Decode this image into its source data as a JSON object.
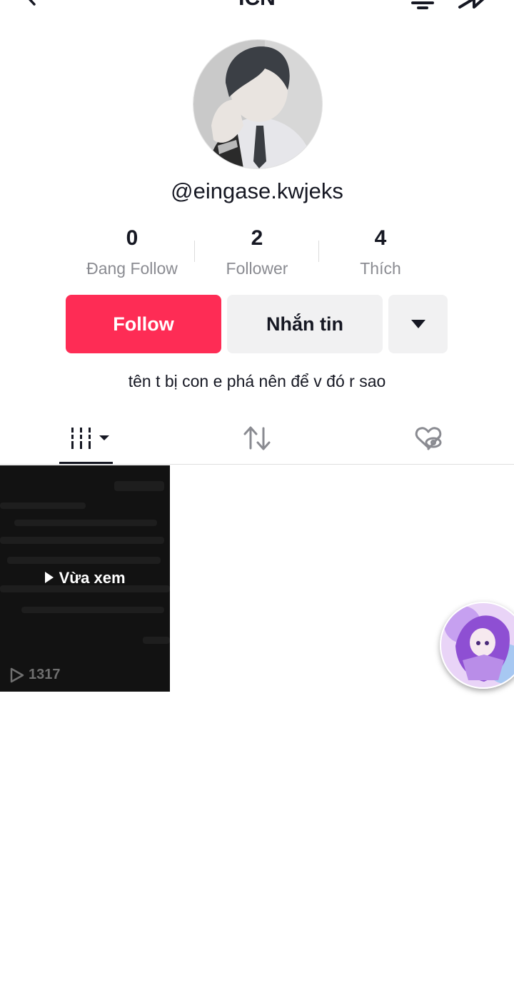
{
  "header": {
    "title": "ICN",
    "back_icon": "chevron-left-icon",
    "bell_icon": "bell-icon",
    "share_icon": "share-icon"
  },
  "profile": {
    "username": "@eingase.kwjeks",
    "bio": "tên t bị con e phá nên để v đó r sao"
  },
  "stats": [
    {
      "value": "0",
      "label": "Đang Follow"
    },
    {
      "value": "2",
      "label": "Follower"
    },
    {
      "value": "4",
      "label": "Thích"
    }
  ],
  "actions": {
    "follow_label": "Follow",
    "message_label": "Nhắn tin",
    "more_icon": "caret-down-icon",
    "follow_color": "#fe2c55"
  },
  "tabs": [
    {
      "icon": "grid-icon",
      "active": true
    },
    {
      "icon": "repost-icon",
      "active": false
    },
    {
      "icon": "liked-hidden-icon",
      "active": false
    }
  ],
  "videos": [
    {
      "overlay_label": "Vừa xem",
      "views": "1317"
    }
  ]
}
